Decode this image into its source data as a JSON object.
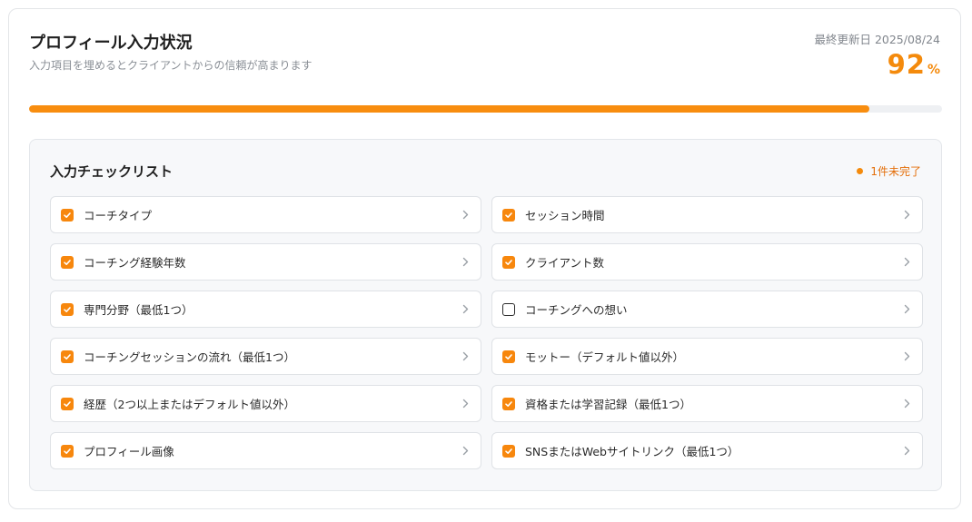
{
  "header": {
    "title": "プロフィール入力状況",
    "subtitle": "入力項目を埋めるとクライアントからの信頼が高まります",
    "updated_label": "最終更新日 2025/08/24",
    "percent_value": "92",
    "percent_sign": "%"
  },
  "progress": {
    "fraction": 0.92,
    "color": "#f88d0f"
  },
  "checklist": {
    "title": "入力チェックリスト",
    "remaining_label": "1件未完了",
    "items": [
      {
        "label": "コーチタイプ",
        "checked": true
      },
      {
        "label": "セッション時間",
        "checked": true
      },
      {
        "label": "コーチング経験年数",
        "checked": true
      },
      {
        "label": "クライアント数",
        "checked": true
      },
      {
        "label": "専門分野（最低1つ）",
        "checked": true
      },
      {
        "label": "コーチングへの想い",
        "checked": false
      },
      {
        "label": "コーチングセッションの流れ（最低1つ）",
        "checked": true
      },
      {
        "label": "モットー（デフォルト値以外）",
        "checked": true
      },
      {
        "label": "経歴（2つ以上またはデフォルト値以外）",
        "checked": true
      },
      {
        "label": "資格または学習記録（最低1つ）",
        "checked": true
      },
      {
        "label": "プロフィール画像",
        "checked": true
      },
      {
        "label": "SNSまたはWebサイトリンク（最低1つ）",
        "checked": true
      }
    ]
  },
  "icons": {
    "checkbox_checked": "checkbox-checked-icon",
    "checkbox_unchecked": "checkbox-unchecked-icon",
    "chevron": "chevron-right-icon"
  },
  "colors": {
    "accent": "#f7870d",
    "warning_text": "#e46f0a"
  }
}
